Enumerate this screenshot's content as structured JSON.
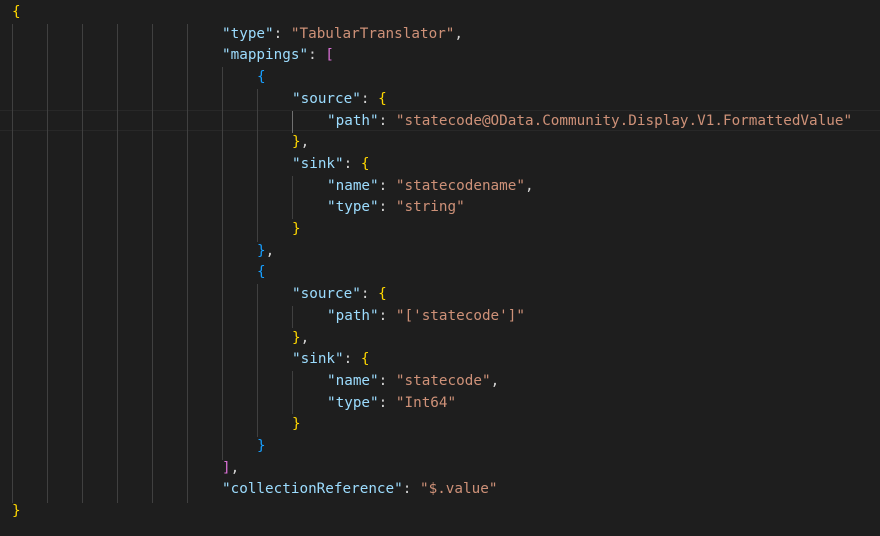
{
  "editor": {
    "language": "json",
    "colors": {
      "background": "#1e1e1e",
      "key": "#9cdcfe",
      "string": "#ce9178",
      "punctuation": "#d4d4d4",
      "bracket_level1": "#ffd700",
      "bracket_level2": "#da70d6",
      "bracket_level3": "#179fff"
    },
    "current_line": 6,
    "lines": [
      {
        "tokens": [
          {
            "t": "{",
            "c": "b1"
          }
        ]
      },
      {
        "tokens": [
          {
            "t": "\"type\"",
            "c": "k"
          },
          {
            "t": ": ",
            "c": "p"
          },
          {
            "t": "\"TabularTranslator\"",
            "c": "s"
          },
          {
            "t": ",",
            "c": "p"
          }
        ]
      },
      {
        "tokens": [
          {
            "t": "\"mappings\"",
            "c": "k"
          },
          {
            "t": ": ",
            "c": "p"
          },
          {
            "t": "[",
            "c": "b2"
          }
        ]
      },
      {
        "tokens": [
          {
            "t": "{",
            "c": "b3"
          }
        ]
      },
      {
        "tokens": [
          {
            "t": "\"source\"",
            "c": "k"
          },
          {
            "t": ": ",
            "c": "p"
          },
          {
            "t": "{",
            "c": "b1"
          }
        ]
      },
      {
        "tokens": [
          {
            "t": "\"path\"",
            "c": "k"
          },
          {
            "t": ": ",
            "c": "p"
          },
          {
            "t": "\"statecode@OData.Community.Display.V1.FormattedValue\"",
            "c": "s"
          }
        ]
      },
      {
        "tokens": [
          {
            "t": "}",
            "c": "b1"
          },
          {
            "t": ",",
            "c": "p"
          }
        ]
      },
      {
        "tokens": [
          {
            "t": "\"sink\"",
            "c": "k"
          },
          {
            "t": ": ",
            "c": "p"
          },
          {
            "t": "{",
            "c": "b1"
          }
        ]
      },
      {
        "tokens": [
          {
            "t": "\"name\"",
            "c": "k"
          },
          {
            "t": ": ",
            "c": "p"
          },
          {
            "t": "\"statecodename\"",
            "c": "s"
          },
          {
            "t": ",",
            "c": "p"
          }
        ]
      },
      {
        "tokens": [
          {
            "t": "\"type\"",
            "c": "k"
          },
          {
            "t": ": ",
            "c": "p"
          },
          {
            "t": "\"string\"",
            "c": "s"
          }
        ]
      },
      {
        "tokens": [
          {
            "t": "}",
            "c": "b1"
          }
        ]
      },
      {
        "tokens": [
          {
            "t": "}",
            "c": "b3"
          },
          {
            "t": ",",
            "c": "p"
          }
        ]
      },
      {
        "tokens": [
          {
            "t": "{",
            "c": "b3"
          }
        ]
      },
      {
        "tokens": [
          {
            "t": "\"source\"",
            "c": "k"
          },
          {
            "t": ": ",
            "c": "p"
          },
          {
            "t": "{",
            "c": "b1"
          }
        ]
      },
      {
        "tokens": [
          {
            "t": "\"path\"",
            "c": "k"
          },
          {
            "t": ": ",
            "c": "p"
          },
          {
            "t": "\"['statecode']\"",
            "c": "s"
          }
        ]
      },
      {
        "tokens": [
          {
            "t": "}",
            "c": "b1"
          },
          {
            "t": ",",
            "c": "p"
          }
        ]
      },
      {
        "tokens": [
          {
            "t": "\"sink\"",
            "c": "k"
          },
          {
            "t": ": ",
            "c": "p"
          },
          {
            "t": "{",
            "c": "b1"
          }
        ]
      },
      {
        "tokens": [
          {
            "t": "\"name\"",
            "c": "k"
          },
          {
            "t": ": ",
            "c": "p"
          },
          {
            "t": "\"statecode\"",
            "c": "s"
          },
          {
            "t": ",",
            "c": "p"
          }
        ]
      },
      {
        "tokens": [
          {
            "t": "\"type\"",
            "c": "k"
          },
          {
            "t": ": ",
            "c": "p"
          },
          {
            "t": "\"Int64\"",
            "c": "s"
          }
        ]
      },
      {
        "tokens": [
          {
            "t": "}",
            "c": "b1"
          }
        ]
      },
      {
        "tokens": [
          {
            "t": "}",
            "c": "b3"
          }
        ]
      },
      {
        "tokens": [
          {
            "t": "]",
            "c": "b2"
          },
          {
            "t": ",",
            "c": "p"
          }
        ]
      },
      {
        "tokens": [
          {
            "t": "\"collectionReference\"",
            "c": "k"
          },
          {
            "t": ": ",
            "c": "p"
          },
          {
            "t": "\"$.value\"",
            "c": "s"
          }
        ]
      },
      {
        "tokens": [
          {
            "t": "}",
            "c": "b1"
          }
        ]
      }
    ]
  }
}
